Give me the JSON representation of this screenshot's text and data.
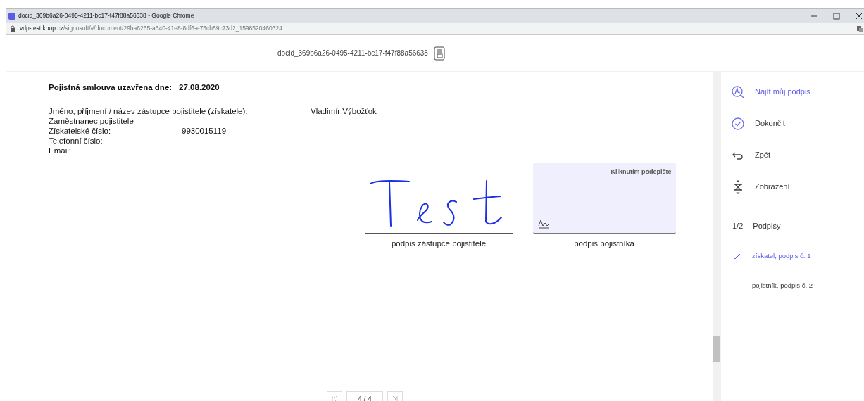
{
  "browser": {
    "title": "docid_369b6a26-0495-4211-bc17-f47f88a56638 - Google Chrome",
    "url_host": "vdp-test.koop.cz",
    "url_path": "/signosoft/#/document/29ba6265-a640-41e8-8df6-e75cb59c73d2_1598520460324"
  },
  "header": {
    "doc_id": "docid_369b6a26-0495-4211-bc17-f47f88a56638"
  },
  "document": {
    "contract_label": "Pojistná smlouva uzavřena dne:",
    "contract_date": "27.08.2020",
    "fields": [
      {
        "label": "Jméno, příjmení / název zástupce pojistitele (získatele):",
        "value": "Vladimír Výbožťok",
        "kind": "wide"
      },
      {
        "label": "Zaměstnanec pojistitele",
        "kind": "plain"
      },
      {
        "label": "Získatelské číslo:",
        "value": "9930015119",
        "kind": "narrow"
      },
      {
        "label": "Telefonní číslo:",
        "kind": "plain"
      },
      {
        "label": "Email:",
        "kind": "plain"
      }
    ],
    "signatures": [
      {
        "caption": "podpis zástupce pojistitele",
        "signed": true
      },
      {
        "caption": "podpis pojistníka",
        "signed": false,
        "hint": "Kliknutím podepište"
      }
    ]
  },
  "pager": {
    "page": "4 / 4"
  },
  "sidebar": {
    "actions": [
      {
        "label": "Najít můj podpis",
        "kind": "find",
        "selected": true
      },
      {
        "label": "Dokončit",
        "kind": "check",
        "selected": false
      },
      {
        "label": "Zpět",
        "kind": "back",
        "selected": false
      },
      {
        "label": "Zobrazení",
        "kind": "view",
        "selected": false
      }
    ],
    "signatures_count": "1/2",
    "signatures_title": "Podpisy",
    "signature_items": [
      {
        "label": "získatel, podpis č. 1",
        "done": true
      },
      {
        "label": "pojistník, podpis č. 2",
        "done": false
      }
    ]
  }
}
